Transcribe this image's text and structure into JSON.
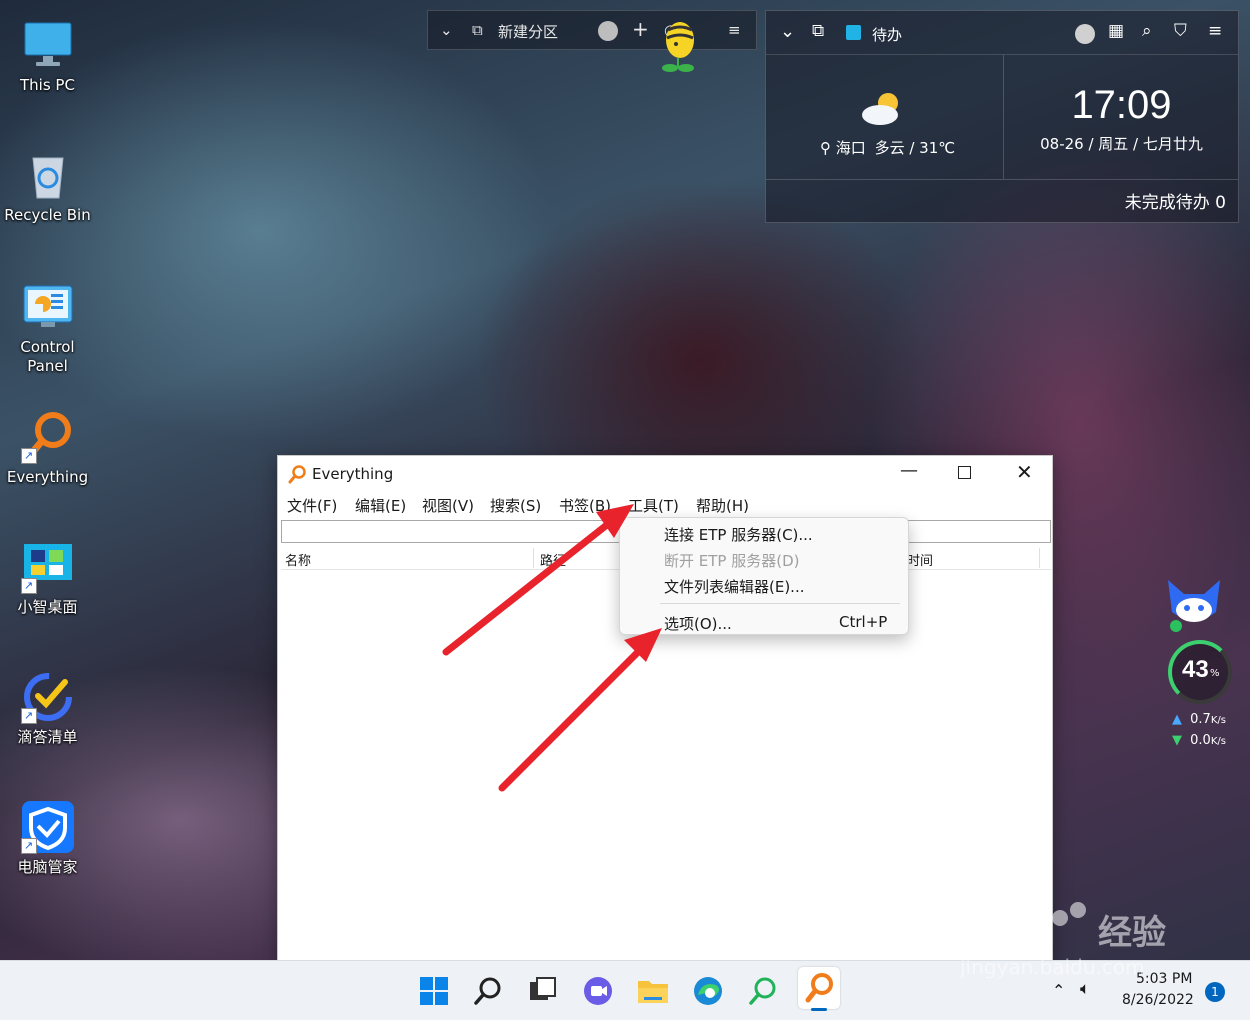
{
  "desktop": {
    "icons": [
      {
        "label": "This PC"
      },
      {
        "label": "Recycle Bin"
      },
      {
        "label": "Control Panel"
      },
      {
        "label": "Everything"
      },
      {
        "label": "小智桌面"
      },
      {
        "label": "滴答清单"
      },
      {
        "label": "电脑管家"
      }
    ]
  },
  "partition_bar": {
    "title": "新建分区"
  },
  "widget": {
    "title": "待办",
    "location": "海口",
    "weather": "多云 / 31℃",
    "time": "17:09",
    "date": "08-26 / 周五 / 七月廿九",
    "todo_status": "未完成待办 0"
  },
  "everything_window": {
    "title": "Everything",
    "menus": [
      "文件(F)",
      "编辑(E)",
      "视图(V)",
      "搜索(S)",
      "书签(B)",
      "工具(T)",
      "帮助(H)"
    ],
    "columns": [
      "名称",
      "路径",
      "修改时间"
    ],
    "search_value": ""
  },
  "context_menu": {
    "items": [
      {
        "label": "连接 ETP 服务器(C)...",
        "shortcut": "",
        "enabled": true
      },
      {
        "label": "断开 ETP 服务器(D)",
        "shortcut": "",
        "enabled": false
      },
      {
        "label": "文件列表编辑器(E)...",
        "shortcut": "",
        "enabled": true
      },
      {
        "label": "选项(O)...",
        "shortcut": "Ctrl+P",
        "enabled": true
      }
    ]
  },
  "monitor": {
    "percent": "43",
    "percent_unit": "%",
    "upload": "0.7",
    "download": "0.0",
    "rate_unit": "K/s"
  },
  "taskbar": {
    "time": "5:03 PM",
    "date": "8/26/2022",
    "notification_count": "1"
  },
  "colors": {
    "arrow": "#e8232b",
    "accent": "#0067c0",
    "everything_orange": "#f07d1a"
  }
}
